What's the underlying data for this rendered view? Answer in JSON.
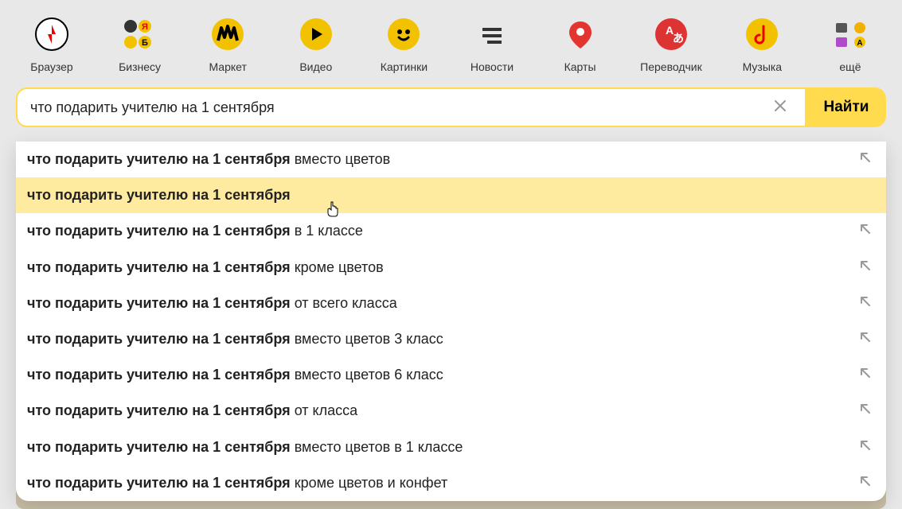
{
  "nav": [
    {
      "label": "Браузер",
      "key": "browser"
    },
    {
      "label": "Бизнесу",
      "key": "business"
    },
    {
      "label": "Маркет",
      "key": "market"
    },
    {
      "label": "Видео",
      "key": "video"
    },
    {
      "label": "Картинки",
      "key": "images"
    },
    {
      "label": "Новости",
      "key": "news"
    },
    {
      "label": "Карты",
      "key": "maps"
    },
    {
      "label": "Переводчик",
      "key": "translate"
    },
    {
      "label": "Музыка",
      "key": "music"
    },
    {
      "label": "ещё",
      "key": "more"
    }
  ],
  "search": {
    "value": "что подарить учителю на 1 сентября",
    "button": "Найти"
  },
  "suggestions": [
    {
      "bold": "что подарить учителю на 1 сентября",
      "rest": " вместо цветов",
      "highlighted": false,
      "arrow": true
    },
    {
      "bold": "что подарить учителю на 1 сентября",
      "rest": "",
      "highlighted": true,
      "arrow": false
    },
    {
      "bold": "что подарить учителю на 1 сентября",
      "rest": " в 1 классе",
      "highlighted": false,
      "arrow": true
    },
    {
      "bold": "что подарить учителю на 1 сентября",
      "rest": " кроме цветов",
      "highlighted": false,
      "arrow": true
    },
    {
      "bold": "что подарить учителю на 1 сентября",
      "rest": " от всего класса",
      "highlighted": false,
      "arrow": true
    },
    {
      "bold": "что подарить учителю на 1 сентября",
      "rest": " вместо цветов 3 класс",
      "highlighted": false,
      "arrow": true
    },
    {
      "bold": "что подарить учителю на 1 сентября",
      "rest": " вместо цветов 6 класс",
      "highlighted": false,
      "arrow": true
    },
    {
      "bold": "что подарить учителю на 1 сентября",
      "rest": " от класса",
      "highlighted": false,
      "arrow": true
    },
    {
      "bold": "что подарить учителю на 1 сентября",
      "rest": " вместо цветов в 1 классе",
      "highlighted": false,
      "arrow": true
    },
    {
      "bold": "что подарить учителю на 1 сентября",
      "rest": " кроме цветов и конфет",
      "highlighted": false,
      "arrow": true
    }
  ]
}
